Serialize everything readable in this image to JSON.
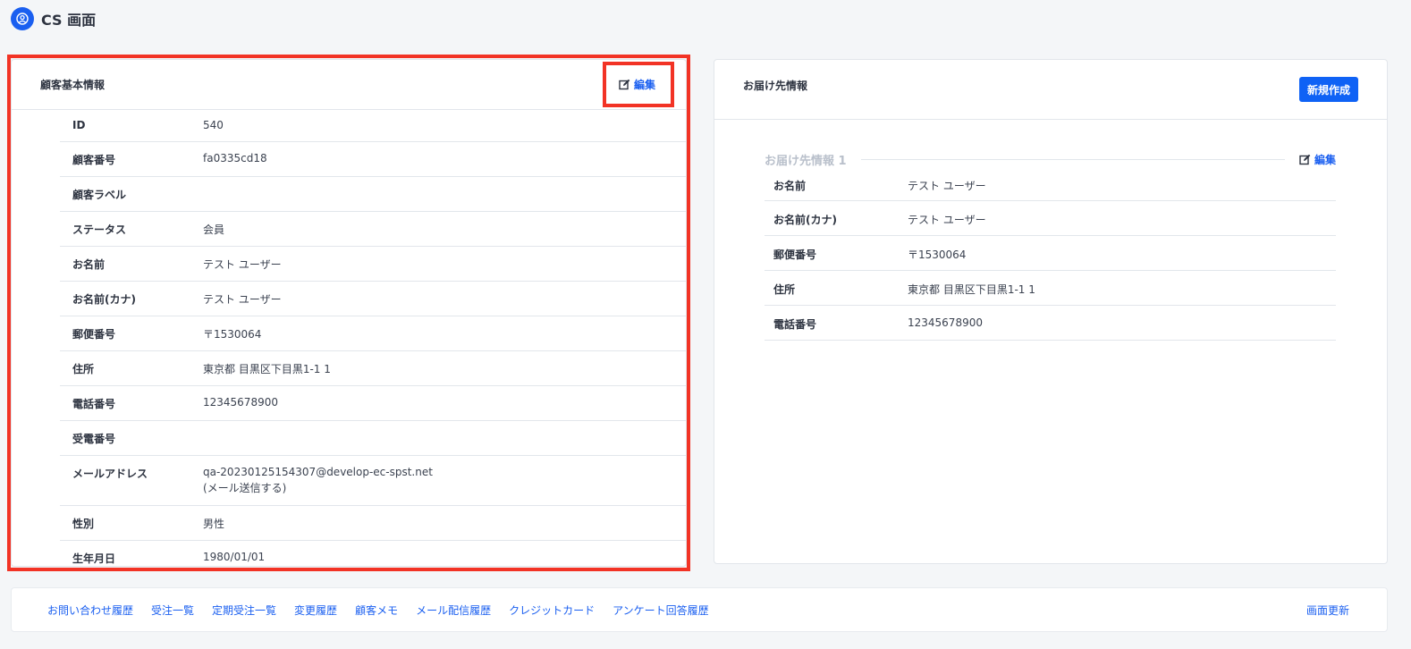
{
  "header": {
    "title": "CS 画面"
  },
  "customer": {
    "title": "顧客基本情報",
    "edit_label": "編集",
    "rows": [
      {
        "key": "ID",
        "value": "540"
      },
      {
        "key": "顧客番号",
        "value": "fa0335cd18"
      },
      {
        "key": "顧客ラベル",
        "value": ""
      },
      {
        "key": "ステータス",
        "value": "会員"
      },
      {
        "key": "お名前",
        "value": "テスト ユーザー"
      },
      {
        "key": "お名前(カナ)",
        "value": "テスト ユーザー"
      },
      {
        "key": "郵便番号",
        "value": "〒1530064"
      },
      {
        "key": "住所",
        "value": "東京都 目黒区下目黒1-1 1"
      },
      {
        "key": "電話番号",
        "value": "12345678900"
      },
      {
        "key": "受電番号",
        "value": ""
      },
      {
        "key": "メールアドレス",
        "value": "qa-20230125154307@develop-ec-spst.net",
        "value2": "(メール送信する)"
      },
      {
        "key": "性別",
        "value": "男性"
      },
      {
        "key": "生年月日",
        "value": "1980/01/01"
      }
    ]
  },
  "delivery": {
    "title": "お届け先情報",
    "new_label": "新規作成",
    "section_title": "お届け先情報 1",
    "edit_label": "編集",
    "rows": [
      {
        "key": "お名前",
        "value": "テスト ユーザー"
      },
      {
        "key": "お名前(カナ)",
        "value": "テスト ユーザー"
      },
      {
        "key": "郵便番号",
        "value": "〒1530064"
      },
      {
        "key": "住所",
        "value": "東京都 目黒区下目黒1-1 1"
      },
      {
        "key": "電話番号",
        "value": "12345678900"
      }
    ]
  },
  "bottom_nav": {
    "links": [
      "お問い合わせ履歴",
      "受注一覧",
      "定期受注一覧",
      "変更履歴",
      "顧客メモ",
      "メール配信履歴",
      "クレジットカード",
      "アンケート回答履歴"
    ],
    "refresh_label": "画面更新"
  },
  "colors": {
    "accent": "#1a5ff0",
    "highlight": "#f23325"
  }
}
